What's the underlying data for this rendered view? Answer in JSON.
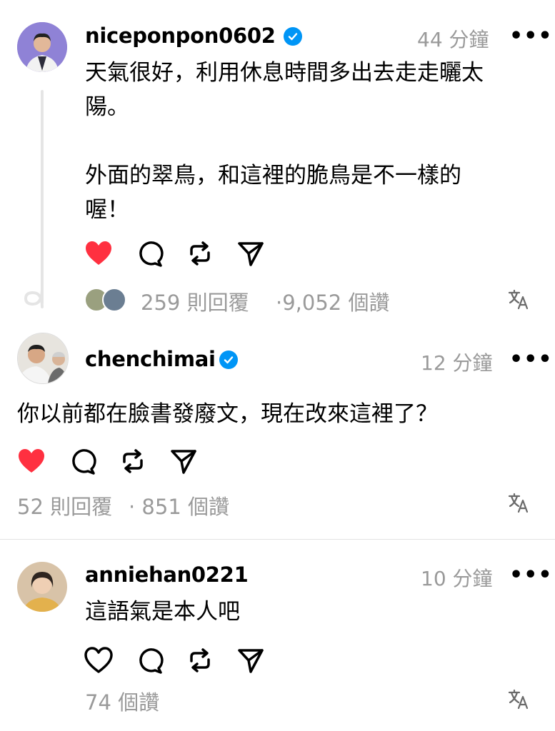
{
  "posts": [
    {
      "username": "niceponpon0602",
      "time": "44 分鐘",
      "more": "•••",
      "text": "天氣很好，利用休息時間多出去走走曬太\n陽。\n\n外面的翠鳥，和這裡的脆鳥是不一樣的\n喔！",
      "replies": "259 則回覆",
      "likes": "·9,052 個讚",
      "liked": true,
      "verified": true
    },
    {
      "username": "chenchimai",
      "time": "12 分鐘",
      "more": "•••",
      "text": "你以前都在臉書發廢文，現在改來這裡了？",
      "replies": "52 則回覆",
      "likes": "· 851 個讚",
      "liked": true,
      "verified": true
    },
    {
      "username": "anniehan0221",
      "time": "10 分鐘",
      "more": "•••",
      "text": "這語氣是本人吧",
      "likes": "74 個讚",
      "liked": false,
      "verified": false
    }
  ],
  "colors": {
    "heart": "#ff3040",
    "verified": "#0095f6",
    "meta": "#9a9a9a"
  },
  "icons": [
    "heart-icon",
    "comment-icon",
    "repost-icon",
    "share-icon",
    "translate-icon",
    "verified-badge-icon",
    "more-icon"
  ]
}
